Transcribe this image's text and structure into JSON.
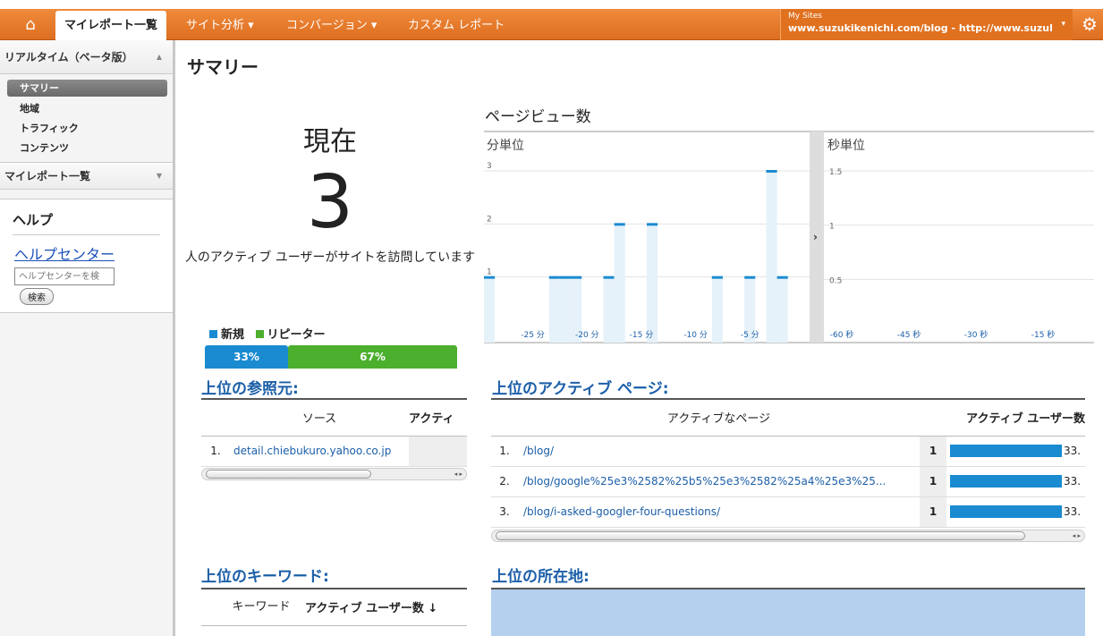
{
  "nav": {
    "home_icon": "home-icon",
    "tabs": [
      "マイレポート一覧",
      "サイト分析 ▾",
      "コンバージョン ▾",
      "カスタム レポート"
    ],
    "site_label": "My Sites",
    "site_name": "www.suzukikenichi.com/blog - http://www.suzukikeni…",
    "gear_icon": "gear-icon"
  },
  "sidebar": {
    "realtime": "リアルタイム（ベータ版）",
    "items": [
      "サマリー",
      "地域",
      "トラフィック",
      "コンテンツ"
    ],
    "myreports": "マイレポート一覧",
    "help_title": "ヘルプ",
    "help_link": "ヘルプセンター",
    "help_placeholder": "ヘルプセンターを検",
    "search_btn": "検索"
  },
  "main": {
    "title": "サマリー",
    "now_label": "現在",
    "active_count": "3",
    "active_desc": "人のアクティブ ユーザーがサイトを訪問しています",
    "legend_new": "新規",
    "legend_returning": "リピーター",
    "new_pct": "33%",
    "ret_pct": "67%",
    "new_frac": 0.33,
    "colors": {
      "new": "#1a8bd0",
      "returning": "#4caf2e",
      "accent": "#1c5fa8"
    },
    "pageviews_title": "ページビュー数",
    "referrers": {
      "title": "上位の参照元:",
      "col_source": "ソース",
      "col_active": "アクティ",
      "rows": [
        {
          "n": "1.",
          "src": "detail.chiebukuro.yahoo.co.jp"
        }
      ]
    },
    "pages": {
      "title": "上位のアクティブ ページ:",
      "col_page": "アクティブなページ",
      "col_users": "アクティブ ユーザー数",
      "rows": [
        {
          "n": "1.",
          "page": "/blog/",
          "count": "1",
          "pct": "33."
        },
        {
          "n": "2.",
          "page": "/blog/google%25e3%2582%25b5%25e3%2582%25a4%25e3%25...",
          "count": "1",
          "pct": "33."
        },
        {
          "n": "3.",
          "page": "/blog/i-asked-googler-four-questions/",
          "count": "1",
          "pct": "33."
        }
      ]
    },
    "keywords": {
      "title": "上位のキーワード:",
      "col_kw": "キーワード",
      "col_users": "アクティブ ユーザー数"
    },
    "locations": {
      "title": "上位の所在地:"
    }
  },
  "chart_data": [
    {
      "type": "bar",
      "title": "分単位",
      "x": [
        -29,
        -28,
        -27,
        -26,
        -25,
        -24,
        -23,
        -22,
        -21,
        -20,
        -19,
        -18,
        -17,
        -16,
        -15,
        -14,
        -13,
        -12,
        -11,
        -10,
        -9,
        -8,
        -7,
        -6,
        -5,
        -4,
        -3,
        -2,
        -1,
        0
      ],
      "values": [
        1,
        0,
        0,
        0,
        0,
        0,
        1,
        1,
        1,
        0,
        0,
        1,
        2,
        0,
        0,
        2,
        0,
        0,
        0,
        0,
        0,
        1,
        0,
        0,
        1,
        0,
        3,
        1,
        0,
        0
      ],
      "ylim": [
        0,
        3
      ],
      "y_ticks": [
        1,
        2,
        3
      ],
      "x_ticks": [
        "-25 分",
        "-20 分",
        "-15 分",
        "-10 分",
        "-5 分"
      ]
    },
    {
      "type": "bar",
      "title": "秒単位",
      "y_ticks": [
        0.5,
        1,
        1.5
      ],
      "ylim": [
        0,
        1.5
      ],
      "x_ticks": [
        "-60 秒",
        "-45 秒",
        "-30 秒",
        "-15 秒"
      ]
    }
  ]
}
